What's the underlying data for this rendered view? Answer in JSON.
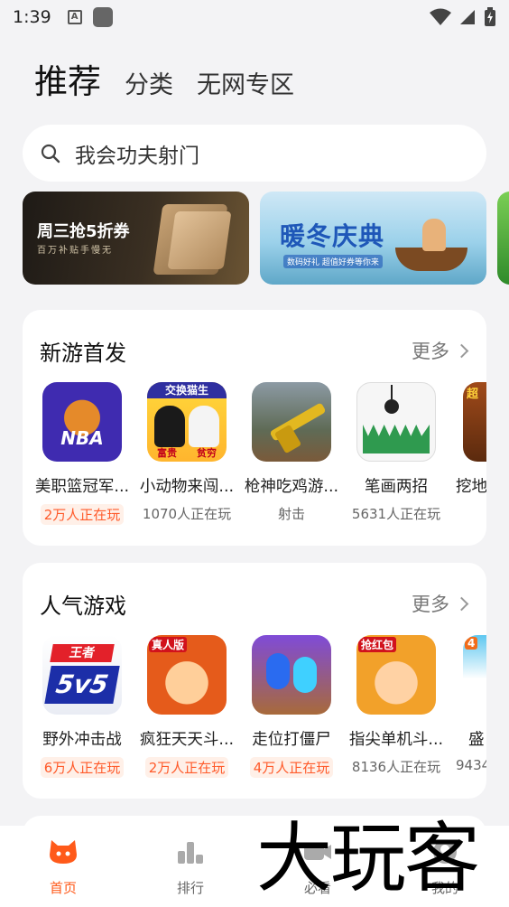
{
  "status_bar": {
    "time": "1:39",
    "notif_icon_letter": "A"
  },
  "top_tabs": [
    {
      "label": "推荐",
      "active": true
    },
    {
      "label": "分类",
      "active": false
    },
    {
      "label": "无网专区",
      "active": false
    }
  ],
  "search": {
    "value": "我会功夫射门"
  },
  "banners": [
    {
      "title": "周三抢5折券",
      "subtitle": "百万补贴手慢无"
    },
    {
      "title": "暖冬庆典",
      "subtitle": "数码好礼 超值好券等你来"
    },
    {
      "title": ""
    }
  ],
  "sections": [
    {
      "title": "新游首发",
      "more": "更多",
      "games": [
        {
          "name": "美职篮冠军...",
          "meta": "2万人正在玩",
          "hot": true,
          "icon_text": "NBA"
        },
        {
          "name": "小动物来闯...",
          "meta": "1070人正在玩",
          "hot": false,
          "icon_text": "交换猫生",
          "icon_foot_left": "富贵",
          "icon_foot_right": "贫穷"
        },
        {
          "name": "枪神吃鸡游...",
          "meta": "射击",
          "hot": false
        },
        {
          "name": "笔画两招",
          "meta": "5631人正在玩",
          "hot": false
        },
        {
          "name": "挖地",
          "meta": "",
          "hot": false,
          "icon_text": "超"
        }
      ]
    },
    {
      "title": "人气游戏",
      "more": "更多",
      "games": [
        {
          "name": "野外冲击战",
          "meta": "6万人正在玩",
          "hot": true,
          "icon_text_top": "王者",
          "icon_text_bottom": "5v5"
        },
        {
          "name": "疯狂天天斗...",
          "meta": "2万人正在玩",
          "hot": true,
          "icon_tag": "真人版"
        },
        {
          "name": "走位打僵尸",
          "meta": "4万人正在玩",
          "hot": true
        },
        {
          "name": "指尖单机斗...",
          "meta": "8136人正在玩",
          "hot": false,
          "icon_tag": "抢红包"
        },
        {
          "name": "盛",
          "meta": "9434",
          "hot": false,
          "icon_tag": "4"
        }
      ]
    }
  ],
  "bottom_nav": [
    {
      "label": "首页",
      "active": true,
      "icon": "home-icon"
    },
    {
      "label": "排行",
      "active": false,
      "icon": "rank-icon"
    },
    {
      "label": "必看",
      "active": false,
      "icon": "video-icon"
    },
    {
      "label": "我的",
      "active": false,
      "icon": "profile-icon"
    }
  ],
  "watermark": {
    "text": "大玩客"
  },
  "colors": {
    "accent": "#ff5a1a",
    "hot_text": "#ff5a2a",
    "hot_bg": "#fff0e8",
    "page_bg": "#f3f3f5"
  }
}
